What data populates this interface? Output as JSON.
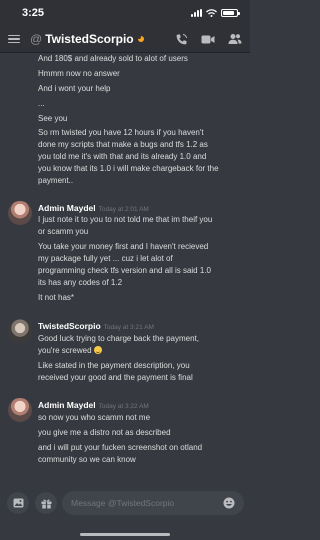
{
  "status_bar": {
    "time": "3:25"
  },
  "header": {
    "channel": "TwistedScorpio",
    "at_symbol": "@"
  },
  "messages": {
    "continuation": [
      "And 180$ and already sold to alot of users",
      "Hmmm now no answer",
      "And i wont your help",
      "...",
      "See you",
      "So rm twisted you have 12 hours if you haven't",
      "done my scripts that make a bugs and tfs 1.2 as",
      "you told me it's with that and its already 1.0 and",
      "you know that its 1.0 i will make chargeback for the",
      "payment.."
    ],
    "group1": {
      "author": "Admin Maydel",
      "timestamp": "Today at 2:01 AM",
      "lines": [
        "I just note it to you to not told me that im theif you",
        "or scamm you",
        "You take your money first and I haven't recieved",
        "my package fully yet ... cuz i let alot of",
        "programming check tfs version and all is said 1.0",
        "its has any codes of 1.2",
        "It not has*"
      ]
    },
    "group2": {
      "author": "TwistedScorpio",
      "timestamp": "Today at 3:21 AM",
      "lines": [
        "Good luck trying to charge back the payment,",
        "you're screwed",
        "Like stated in the payment description, you",
        "received your good and the payment is final"
      ]
    },
    "group3": {
      "author": "Admin Maydel",
      "timestamp": "Today at 3:22 AM",
      "lines": [
        "so now you who scamm not me",
        "you give me a distro not as described",
        "and i will put your fucken screenshot on otland",
        "community so we can know"
      ]
    }
  },
  "composer": {
    "placeholder": "Message @TwistedScorpio"
  },
  "icons": {
    "menu": "hamburger-icon",
    "call": "phone-call-icon",
    "video": "video-camera-icon",
    "members": "members-icon",
    "image": "image-icon",
    "gift": "gift-icon",
    "emoji": "emoji-icon"
  },
  "colors": {
    "background": "#36393f",
    "header": "#2f3136",
    "text": "#dcddde",
    "muted": "#72767d",
    "idle_status": "#faa61a"
  }
}
